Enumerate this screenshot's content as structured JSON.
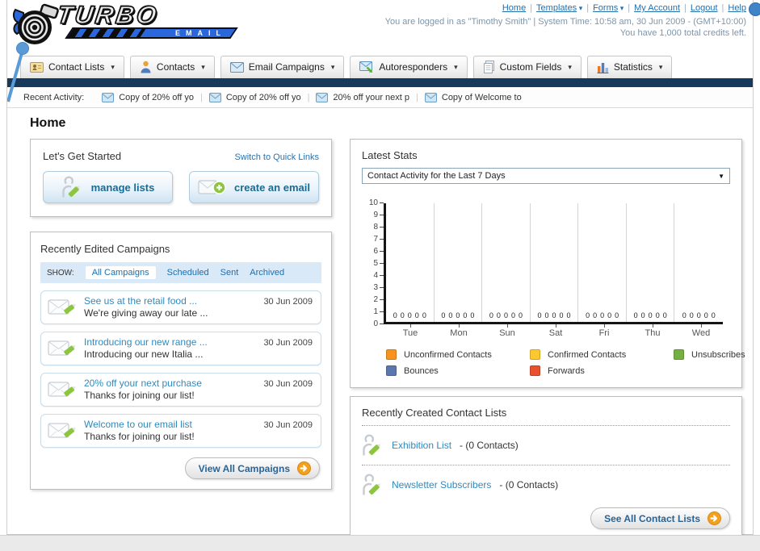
{
  "header": {
    "logo_title": "TURBO",
    "logo_subtitle": "EMAIL",
    "nav_links": [
      {
        "label": "Home",
        "dropdown": false
      },
      {
        "label": "Templates",
        "dropdown": true
      },
      {
        "label": "Forms",
        "dropdown": true
      },
      {
        "label": "My Account",
        "dropdown": false
      },
      {
        "label": "Logout",
        "dropdown": false
      },
      {
        "label": "Help",
        "dropdown": false
      }
    ],
    "login_status": "You are logged in as \"Timothy Smith\" | System Time: 10:58 am, 30 Jun 2009 - (GMT+10:00)",
    "credits": "You have 1,000 total credits left."
  },
  "tabs": [
    {
      "label": "Contact Lists",
      "icon": "contact-card-icon"
    },
    {
      "label": "Contacts",
      "icon": "person-icon"
    },
    {
      "label": "Email Campaigns",
      "icon": "envelope-icon"
    },
    {
      "label": "Autoresponders",
      "icon": "envelope-arrow-icon"
    },
    {
      "label": "Custom Fields",
      "icon": "document-icon"
    },
    {
      "label": "Statistics",
      "icon": "bar-chart-icon"
    }
  ],
  "recent_activity": {
    "label": "Recent Activity:",
    "items": [
      "Copy of 20% off yo",
      "Copy of 20% off yo",
      "20% off your next p",
      "Copy of Welcome to"
    ]
  },
  "page_title": "Home",
  "get_started": {
    "title": "Let's Get Started",
    "switch_link": "Switch to Quick Links",
    "buttons": [
      {
        "label": "manage lists",
        "icon": "person-pencil-icon"
      },
      {
        "label": "create an email",
        "icon": "envelope-plus-icon"
      }
    ]
  },
  "campaigns": {
    "title": "Recently Edited Campaigns",
    "show_label": "SHOW:",
    "filters": [
      "All Campaigns",
      "Scheduled",
      "Sent",
      "Archived"
    ],
    "active_filter": "All Campaigns",
    "items": [
      {
        "title": "See us at the retail food ...",
        "subtitle": "We're giving away our late ...",
        "date": "30 Jun 2009"
      },
      {
        "title": "Introducing our new range ...",
        "subtitle": "Introducing our new Italia ...",
        "date": "30 Jun 2009"
      },
      {
        "title": "20% off your next purchase",
        "subtitle": "Thanks for joining our list!",
        "date": "30 Jun 2009"
      },
      {
        "title": "Welcome to our email list",
        "subtitle": "Thanks for joining our list!",
        "date": "30 Jun 2009"
      }
    ],
    "view_all_label": "View All Campaigns"
  },
  "latest_stats": {
    "title": "Latest Stats",
    "dropdown_value": "Contact Activity for the Last 7 Days"
  },
  "chart_data": {
    "type": "bar",
    "title": "Contact Activity for the Last 7 Days",
    "categories": [
      "Tue",
      "Mon",
      "Sun",
      "Sat",
      "Fri",
      "Thu",
      "Wed"
    ],
    "series": [
      {
        "name": "Unconfirmed Contacts",
        "color": "#F7941E",
        "values": [
          0,
          0,
          0,
          0,
          0,
          0,
          0
        ]
      },
      {
        "name": "Confirmed Contacts",
        "color": "#FDC72F",
        "values": [
          0,
          0,
          0,
          0,
          0,
          0,
          0
        ]
      },
      {
        "name": "Unsubscribes",
        "color": "#76B043",
        "values": [
          0,
          0,
          0,
          0,
          0,
          0,
          0
        ]
      },
      {
        "name": "Bounces",
        "color": "#5C77AE",
        "values": [
          0,
          0,
          0,
          0,
          0,
          0,
          0
        ]
      },
      {
        "name": "Forwards",
        "color": "#E8502E",
        "values": [
          0,
          0,
          0,
          0,
          0,
          0,
          0
        ]
      }
    ],
    "ylim": [
      0,
      10
    ],
    "yticks": [
      0,
      1,
      2,
      3,
      4,
      5,
      6,
      7,
      8,
      9,
      10
    ],
    "grid": "vertical",
    "legend_position": "bottom",
    "data_labels_shown": true
  },
  "contact_lists": {
    "title": "Recently Created Contact Lists",
    "items": [
      {
        "name": "Exhibition List",
        "detail": "- (0 Contacts)"
      },
      {
        "name": "Newsletter Subscribers",
        "detail": "- (0 Contacts)"
      }
    ],
    "see_all_label": "See All Contact Lists"
  },
  "colors": {
    "navy_bar": "#173A5C",
    "link_blue": "#2573B4",
    "logo_blue": "#2B66DB",
    "button_orange": "#F3A01C"
  }
}
